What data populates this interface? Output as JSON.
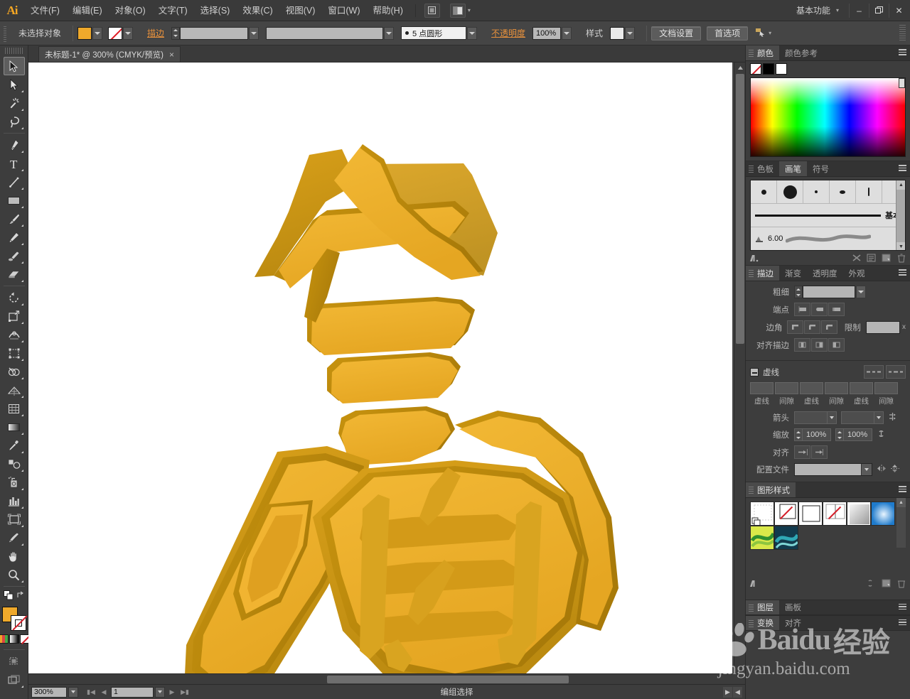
{
  "app": {
    "logo": "Ai",
    "workspace": "基本功能"
  },
  "menubar": {
    "items": [
      {
        "label": "文件(F)"
      },
      {
        "label": "编辑(E)"
      },
      {
        "label": "对象(O)"
      },
      {
        "label": "文字(T)"
      },
      {
        "label": "选择(S)"
      },
      {
        "label": "效果(C)"
      },
      {
        "label": "视图(V)"
      },
      {
        "label": "窗口(W)"
      },
      {
        "label": "帮助(H)"
      }
    ],
    "bridge_icon": "bridge-icon",
    "arrange_icon": "arrange-documents-icon",
    "minimize": "–",
    "maximize": "❐",
    "close": "✕"
  },
  "controlbar": {
    "selection_status": "未选择对象",
    "fill_label": "fill-swatch",
    "stroke_label": "描边",
    "stroke_weight": "",
    "stroke_profile": "",
    "brush_def": "5 点圆形",
    "opacity_label": "不透明度",
    "opacity_value": "100%",
    "style_label": "样式",
    "document_setup": "文档设置",
    "preferences": "首选项",
    "select_similar": "select-similar-icon"
  },
  "document": {
    "tab_title": "未标题-1* @ 300% (CMYK/预览)",
    "close": "×"
  },
  "toolbar": {
    "tools": [
      {
        "name": "selection-tool",
        "active": true
      },
      {
        "name": "direct-selection-tool",
        "active": false
      },
      {
        "name": "magic-wand-tool",
        "active": false
      },
      {
        "name": "lasso-tool",
        "active": false
      },
      {
        "name": "pen-tool",
        "active": false
      },
      {
        "name": "type-tool",
        "active": false
      },
      {
        "name": "line-segment-tool",
        "active": false
      },
      {
        "name": "rectangle-tool",
        "active": false
      },
      {
        "name": "paintbrush-tool",
        "active": false
      },
      {
        "name": "pencil-tool",
        "active": false
      },
      {
        "name": "blob-brush-tool",
        "active": false
      },
      {
        "name": "eraser-tool",
        "active": false
      },
      {
        "name": "rotate-tool",
        "active": false
      },
      {
        "name": "scale-tool",
        "active": false
      },
      {
        "name": "width-tool",
        "active": false
      },
      {
        "name": "free-transform-tool",
        "active": false
      },
      {
        "name": "shape-builder-tool",
        "active": false
      },
      {
        "name": "perspective-grid-tool",
        "active": false
      },
      {
        "name": "mesh-tool",
        "active": false
      },
      {
        "name": "gradient-tool",
        "active": false
      },
      {
        "name": "eyedropper-tool",
        "active": false
      },
      {
        "name": "blend-tool",
        "active": false
      },
      {
        "name": "symbol-sprayer-tool",
        "active": false
      },
      {
        "name": "column-graph-tool",
        "active": false
      },
      {
        "name": "artboard-tool",
        "active": false
      },
      {
        "name": "slice-tool",
        "active": false
      },
      {
        "name": "hand-tool",
        "active": false
      },
      {
        "name": "zoom-tool",
        "active": false
      }
    ],
    "fill_color": "#efa92b",
    "stroke_color": "none",
    "screen_mode": "screen-mode-icon"
  },
  "color_panel": {
    "tabs": [
      {
        "label": "颜色",
        "active": true
      },
      {
        "label": "颜色参考",
        "active": false
      }
    ],
    "swatches": [
      "none",
      "#000000",
      "#ffffff"
    ]
  },
  "brushes_panel": {
    "tabs": [
      {
        "label": "色板",
        "active": false
      },
      {
        "label": "画笔",
        "active": true
      },
      {
        "label": "符号",
        "active": false
      }
    ],
    "basic_label": "基本",
    "size_value": "6.00"
  },
  "stroke_panel": {
    "tabs": [
      {
        "label": "描边",
        "active": true
      },
      {
        "label": "渐变",
        "active": false
      },
      {
        "label": "透明度",
        "active": false
      },
      {
        "label": "外观",
        "active": false
      }
    ],
    "weight_label": "粗细",
    "weight_value": "",
    "cap_label": "端点",
    "corner_label": "边角",
    "limit_label": "限制",
    "limit_unit": "x",
    "align_label": "对齐描边",
    "dash_label": "虚线",
    "dash_fields": [
      "虚线",
      "间隙",
      "虚线",
      "间隙",
      "虚线",
      "间隙"
    ],
    "arrow_label": "箭头",
    "scale_label": "缩放",
    "scale_value_1": "100%",
    "scale_value_2": "100%",
    "align_arrow_label": "对齐",
    "profile_label": "配置文件"
  },
  "graphic_styles_panel": {
    "title": "图形样式",
    "swatch_count": 8
  },
  "bottom_panels": {
    "layers_tabs": [
      {
        "label": "图层",
        "active": true
      },
      {
        "label": "画板",
        "active": false
      }
    ],
    "transform_tabs": [
      {
        "label": "变换",
        "active": true
      },
      {
        "label": "对齐",
        "active": false
      }
    ]
  },
  "statusbar": {
    "zoom": "300%",
    "page": "1",
    "status_text": "编组选择"
  },
  "artwork": {
    "description": "3D extruded Chinese calligraphy characters",
    "face_color": "#eeb02e",
    "side_color": "#c18a17",
    "shadow_color": "#a8760d",
    "background": "#ffffff"
  },
  "watermark": {
    "brand": "Baidu",
    "brand_cn": "经验",
    "url": "jingyan.baidu.com"
  }
}
